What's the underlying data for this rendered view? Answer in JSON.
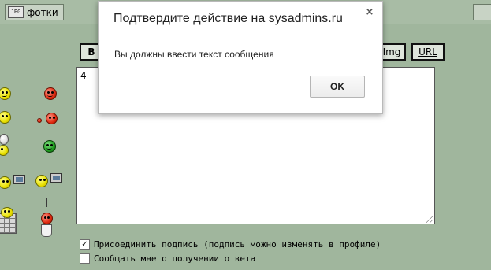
{
  "toolbar": {
    "photos_label": "фотки",
    "photos_icon": "jpg-file-icon"
  },
  "bbcode": {
    "bold_label": "B",
    "img_label": "Img",
    "url_label": "URL"
  },
  "message": {
    "value": "4"
  },
  "options": {
    "attach_signature": {
      "label": "Присоединить подпись (подпись можно изменять в профиле)",
      "checked": true
    },
    "notify_reply": {
      "label": "Сообщать мне о получении ответа",
      "checked": false
    }
  },
  "dialog": {
    "title": "Подтвердите действие на sysadmins.ru",
    "message": "Вы должны ввести текст сообщения",
    "ok_label": "OK",
    "close_glyph": "×"
  },
  "check_glyph": "✓",
  "colors": {
    "page_bg": "#a0b69d",
    "dialog_bg": "#ffffff"
  }
}
